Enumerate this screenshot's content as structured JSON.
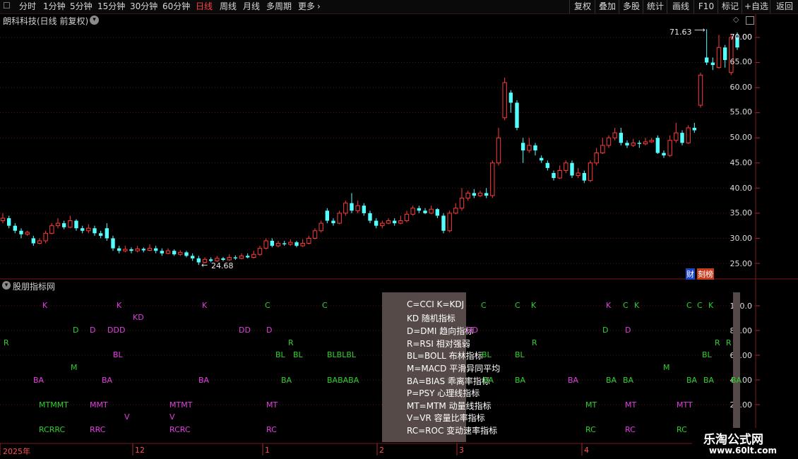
{
  "toolbar": {
    "left_items": [
      "分时",
      "1分钟",
      "5分钟",
      "15分钟",
      "30分钟",
      "60分钟",
      "日线",
      "周线",
      "月线",
      "多周期",
      "更多"
    ],
    "active": "日线",
    "right_items": [
      "复权",
      "叠加",
      "多股",
      "统计",
      "画线",
      "F10",
      "标记",
      "+自选",
      "返回"
    ]
  },
  "chart_header": {
    "title": "朗科科技(日线 前复权)"
  },
  "price_axis": {
    "ticks": [
      "70.00",
      "65.00",
      "60.00",
      "55.00",
      "50.00",
      "45.00",
      "40.00",
      "35.00",
      "30.00",
      "25.00"
    ]
  },
  "annotations": {
    "high": "71.63",
    "low": "24.68"
  },
  "badges": {
    "fin": "财",
    "bang": "刻榜"
  },
  "indicator_panel": {
    "title": "股朋指标网",
    "axis_ticks": [
      "100.0",
      "80.00",
      "60.00",
      "40.00",
      "20.00"
    ],
    "legend": [
      "C=CCI K=KDJ",
      "KD 随机指标",
      "D=DMI 趋向指标",
      "R=RSI 相对强弱",
      "BL=BOLL 布林指标",
      "M=MACD 平滑异同平均",
      "BA=BIAS 乖离率指标",
      "P=PSY 心理线指标",
      "MT=MTM 动量线指标",
      "V=VR 容量比率指标",
      "RC=ROC 变动速率指标"
    ]
  },
  "date_axis": {
    "labels": [
      "2025年",
      "12",
      "1",
      "2",
      "3",
      "4"
    ]
  },
  "watermark": {
    "title": "乐淘公式网",
    "url": "www.60lt.com"
  },
  "colors": {
    "up": "#ff3b3b",
    "down": "#54ffff",
    "magenta": "#e040e0",
    "green": "#30d030"
  },
  "chart_data": {
    "type": "candlestick",
    "y_range": [
      22,
      73
    ],
    "candles": [
      [
        33.5,
        34.0,
        35.0,
        33.0
      ],
      [
        34.0,
        32.5,
        34.5,
        32.0
      ],
      [
        32.5,
        31.5,
        33.0,
        31.0
      ],
      [
        31.5,
        30.8,
        32.0,
        30.0
      ],
      [
        30.8,
        31.2,
        31.5,
        30.5
      ],
      [
        30.0,
        29.0,
        30.5,
        28.5
      ],
      [
        29.0,
        29.5,
        30.0,
        28.8
      ],
      [
        29.5,
        31.0,
        31.5,
        29.0
      ],
      [
        31.0,
        32.5,
        33.0,
        30.8
      ],
      [
        32.5,
        33.0,
        34.0,
        32.0
      ],
      [
        33.0,
        32.2,
        33.5,
        31.8
      ],
      [
        32.2,
        33.5,
        34.5,
        32.0
      ],
      [
        33.5,
        32.0,
        33.8,
        31.5
      ],
      [
        32.0,
        31.5,
        32.5,
        31.0
      ],
      [
        31.5,
        32.0,
        32.8,
        31.0
      ],
      [
        32.0,
        31.0,
        32.5,
        30.5
      ],
      [
        31.0,
        30.5,
        31.5,
        30.0
      ],
      [
        32.0,
        30.0,
        33.0,
        29.5
      ],
      [
        30.0,
        28.0,
        30.5,
        27.5
      ],
      [
        28.0,
        27.5,
        28.5,
        27.0
      ],
      [
        27.5,
        27.8,
        28.5,
        27.2
      ],
      [
        27.8,
        27.5,
        28.2,
        27.0
      ],
      [
        27.5,
        27.9,
        28.5,
        27.2
      ],
      [
        27.9,
        27.6,
        28.2,
        27.2
      ],
      [
        27.6,
        28.0,
        28.8,
        27.4
      ],
      [
        28.0,
        27.5,
        28.5,
        27.0
      ],
      [
        27.5,
        27.0,
        28.0,
        26.5
      ],
      [
        27.0,
        27.5,
        28.0,
        26.8
      ],
      [
        27.5,
        26.8,
        27.8,
        26.5
      ],
      [
        26.8,
        27.2,
        27.6,
        26.5
      ],
      [
        27.2,
        26.5,
        27.5,
        26.2
      ],
      [
        26.5,
        26.0,
        27.0,
        25.5
      ],
      [
        26.0,
        25.2,
        26.5,
        24.68
      ],
      [
        25.2,
        25.8,
        26.2,
        25.0
      ],
      [
        25.8,
        25.5,
        26.2,
        25.2
      ],
      [
        25.5,
        26.0,
        26.5,
        25.3
      ],
      [
        26.0,
        25.7,
        26.3,
        25.4
      ],
      [
        25.7,
        26.2,
        26.8,
        25.5
      ],
      [
        26.2,
        26.0,
        26.6,
        25.7
      ],
      [
        26.0,
        26.5,
        27.0,
        25.8
      ],
      [
        26.5,
        26.2,
        27.0,
        26.0
      ],
      [
        26.2,
        26.8,
        27.5,
        26.0
      ],
      [
        26.8,
        28.0,
        28.5,
        26.5
      ],
      [
        28.0,
        29.5,
        30.0,
        27.8
      ],
      [
        29.5,
        28.5,
        30.0,
        28.2
      ],
      [
        28.5,
        29.0,
        29.5,
        28.2
      ],
      [
        29.0,
        28.8,
        29.5,
        28.5
      ],
      [
        28.8,
        29.2,
        29.8,
        28.5
      ],
      [
        29.2,
        28.5,
        29.5,
        28.2
      ],
      [
        28.5,
        29.0,
        29.8,
        28.3
      ],
      [
        29.0,
        30.0,
        30.5,
        28.8
      ],
      [
        30.0,
        31.5,
        32.0,
        29.8
      ],
      [
        31.5,
        33.0,
        33.5,
        31.2
      ],
      [
        35.5,
        33.5,
        36.0,
        33.0
      ],
      [
        33.5,
        33.0,
        34.0,
        32.5
      ],
      [
        33.0,
        35.0,
        35.5,
        32.8
      ],
      [
        35.0,
        37.0,
        37.5,
        34.5
      ],
      [
        37.0,
        35.5,
        39.0,
        35.0
      ],
      [
        35.5,
        36.5,
        37.5,
        35.0
      ],
      [
        36.5,
        35.0,
        37.0,
        34.5
      ],
      [
        35.0,
        33.5,
        35.5,
        33.0
      ],
      [
        33.5,
        32.5,
        34.0,
        32.0
      ],
      [
        32.5,
        33.0,
        33.5,
        32.0
      ],
      [
        33.0,
        33.5,
        34.0,
        32.8
      ],
      [
        33.5,
        33.0,
        34.0,
        32.5
      ],
      [
        33.0,
        33.5,
        34.5,
        32.8
      ],
      [
        33.5,
        34.8,
        35.5,
        33.2
      ],
      [
        34.8,
        36.0,
        36.5,
        34.5
      ],
      [
        36.0,
        35.5,
        36.5,
        35.0
      ],
      [
        35.5,
        35.0,
        36.0,
        34.8
      ],
      [
        35.0,
        35.8,
        36.5,
        34.8
      ],
      [
        35.8,
        34.5,
        36.0,
        34.0
      ],
      [
        34.5,
        31.5,
        35.0,
        31.0
      ],
      [
        31.5,
        35.0,
        35.5,
        31.2
      ],
      [
        35.0,
        36.0,
        37.0,
        34.8
      ],
      [
        36.0,
        38.0,
        40.0,
        35.5
      ],
      [
        38.0,
        39.0,
        39.5,
        37.5
      ],
      [
        39.0,
        38.5,
        39.8,
        38.0
      ],
      [
        38.5,
        39.0,
        39.5,
        38.2
      ],
      [
        39.0,
        38.5,
        40.0,
        38.0
      ],
      [
        38.5,
        45.0,
        45.5,
        38.0
      ],
      [
        45.0,
        50.0,
        52.0,
        44.5
      ],
      [
        54.0,
        61.0,
        62.0,
        53.5
      ],
      [
        59.0,
        57.0,
        59.5,
        55.0
      ],
      [
        57.0,
        52.0,
        57.5,
        51.5
      ],
      [
        49.0,
        47.5,
        50.0,
        45.0
      ],
      [
        47.5,
        48.5,
        50.0,
        47.0
      ],
      [
        48.5,
        47.5,
        49.0,
        46.5
      ],
      [
        46.0,
        45.5,
        46.5,
        45.0
      ],
      [
        45.0,
        44.0,
        45.5,
        43.5
      ],
      [
        43.0,
        42.0,
        43.5,
        41.5
      ],
      [
        42.0,
        43.5,
        44.5,
        41.8
      ],
      [
        43.5,
        45.0,
        45.5,
        43.0
      ],
      [
        45.0,
        42.5,
        45.5,
        42.0
      ],
      [
        42.5,
        43.0,
        44.0,
        42.0
      ],
      [
        43.0,
        41.5,
        43.5,
        41.0
      ],
      [
        41.5,
        45.0,
        45.5,
        41.2
      ],
      [
        45.0,
        47.0,
        48.0,
        44.5
      ],
      [
        47.0,
        48.5,
        50.0,
        46.8
      ],
      [
        48.5,
        50.0,
        50.5,
        48.0
      ],
      [
        50.0,
        51.0,
        52.0,
        49.5
      ],
      [
        51.0,
        49.0,
        52.0,
        48.5
      ],
      [
        49.0,
        48.5,
        49.5,
        48.0
      ],
      [
        48.5,
        49.0,
        49.8,
        48.2
      ],
      [
        49.0,
        48.8,
        49.5,
        48.0
      ],
      [
        48.8,
        49.2,
        50.0,
        48.5
      ],
      [
        49.2,
        49.5,
        50.0,
        49.0
      ],
      [
        50.0,
        47.0,
        50.5,
        46.8
      ],
      [
        47.0,
        46.5,
        47.5,
        46.0
      ],
      [
        46.5,
        49.5,
        50.5,
        46.2
      ],
      [
        49.5,
        51.0,
        53.0,
        49.0
      ],
      [
        51.0,
        49.0,
        51.5,
        48.5
      ],
      [
        49.0,
        52.0,
        52.5,
        48.8
      ],
      [
        52.0,
        51.5,
        53.0,
        51.0
      ],
      [
        56.5,
        62.5,
        63.0,
        56.0
      ],
      [
        66.0,
        65.0,
        71.63,
        64.5
      ],
      [
        65.0,
        64.5,
        66.0,
        63.5
      ],
      [
        64.0,
        68.0,
        70.5,
        63.8
      ],
      [
        68.0,
        65.5,
        68.5,
        64.0
      ],
      [
        63.0,
        70.0,
        70.5,
        62.5
      ],
      [
        70.0,
        68.0,
        71.0,
        67.5
      ]
    ]
  }
}
